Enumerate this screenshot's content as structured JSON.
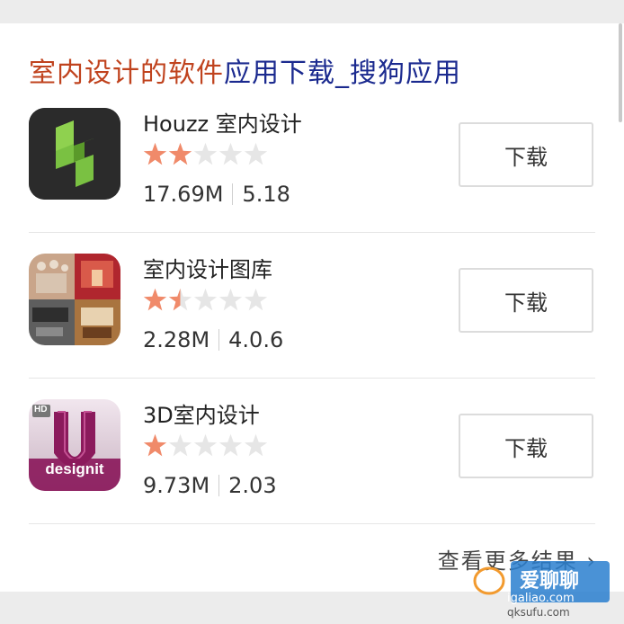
{
  "header": {
    "title_highlight": "室内设计的软件",
    "title_rest": "应用下载_搜狗应用"
  },
  "apps": [
    {
      "name": "Houzz 室内设计",
      "rating": 2,
      "size": "17.69M",
      "version": "5.18",
      "download_label": "下载"
    },
    {
      "name": "室内设计图库",
      "rating": 1.5,
      "size": "2.28M",
      "version": "4.0.6",
      "download_label": "下载"
    },
    {
      "name": "3D室内设计",
      "rating": 1,
      "size": "9.73M",
      "version": "2.03",
      "download_label": "下载"
    }
  ],
  "icons": {
    "houzz": {
      "text": "",
      "bg": "#2b2b2b",
      "accent": "#7ac142"
    },
    "gallery": {
      "text": ""
    },
    "designit": {
      "badge": "HD",
      "label": "designit",
      "bg": "#8b1a5c"
    }
  },
  "footer": {
    "more_label": "查看更多结果 ›"
  },
  "watermark": {
    "line1": "爱聊聊",
    "line2": "igaliao.com",
    "line3": "qksufu.com"
  },
  "colors": {
    "title_highlight": "#c0431e",
    "title_link": "#1b2a8f",
    "star": "#f08a6a"
  }
}
